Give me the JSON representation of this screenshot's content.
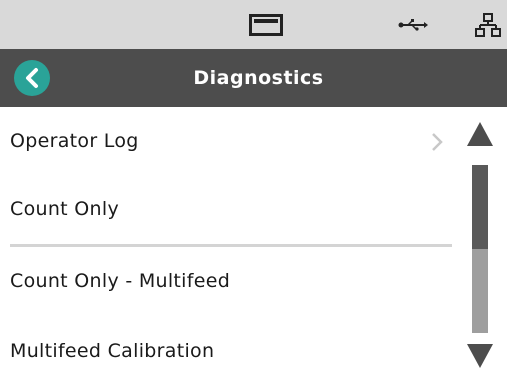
{
  "status_bar": {
    "icons": [
      "display-icon",
      "usb-icon",
      "network-icon"
    ]
  },
  "header": {
    "title": "Diagnostics",
    "back_icon": "chevron-left-icon"
  },
  "list": {
    "items": [
      {
        "label": "Operator Log",
        "has_chevron": true
      },
      {
        "label": "Count Only",
        "has_chevron": false
      },
      {
        "label": "Count Only - Multifeed",
        "has_chevron": false
      },
      {
        "label": "Multifeed Calibration",
        "has_chevron": false
      }
    ]
  },
  "scrollbar": {
    "position_fraction": 0.0,
    "visible_fraction": 0.5
  },
  "colors": {
    "status_bar_bg": "#d9d9d9",
    "header_bg": "#4d4d4d",
    "accent": "#2aa398",
    "scroll_track": "#9e9e9e",
    "scroll_thumb": "#595959"
  }
}
